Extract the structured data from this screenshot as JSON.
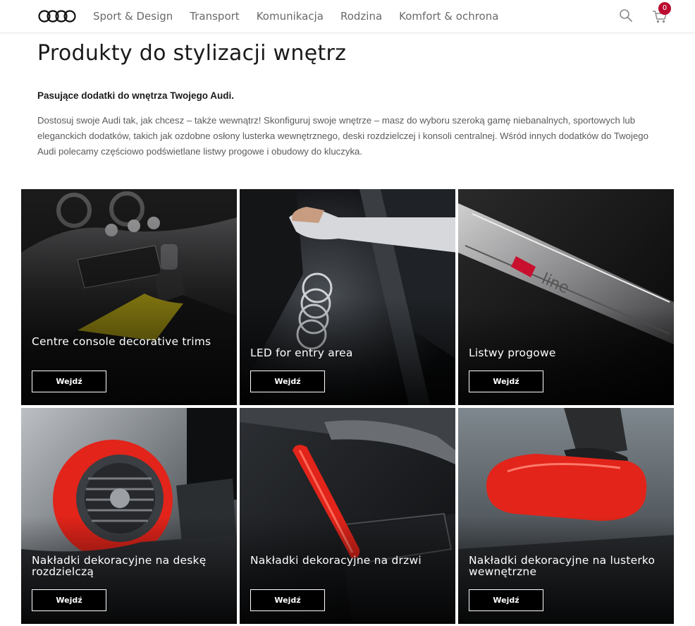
{
  "header": {
    "logo_name": "audi-rings-logo",
    "nav": [
      {
        "label": "Sport & Design"
      },
      {
        "label": "Transport"
      },
      {
        "label": "Komunikacja"
      },
      {
        "label": "Rodzina"
      },
      {
        "label": "Komfort & ochrona"
      }
    ],
    "search_icon": "search-icon",
    "cart_icon": "cart-icon",
    "cart_count": "0"
  },
  "page": {
    "title": "Produkty do stylizacji wnętrz",
    "lead": "Pasujące dodatki do wnętrza Twojego Audi.",
    "description": "Dostosuj swoje Audi tak, jak chcesz – także wewnątrz! Skonfiguruj swoje wnętrze – masz do wyboru szeroką gamę niebanalnych, sportowych lub eleganckich dodatków, takich jak ozdobne osłony lusterka wewnętrznego, deski rozdzielczej i konsoli centralnej. Wśród innych dodatków do Twojego Audi polecamy częściowo podświetlane listwy progowe i obudowy do kluczyka."
  },
  "tiles": [
    {
      "title": "Centre console decorative trims",
      "button": "Wejdź"
    },
    {
      "title": "LED for entry area",
      "button": "Wejdź"
    },
    {
      "title": "Listwy progowe",
      "button": "Wejdź",
      "badge_text": "line"
    },
    {
      "title": "Nakładki dekoracyjne na deskę rozdzielczą",
      "button": "Wejdź"
    },
    {
      "title": "Nakładki dekoracyjne na drzwi",
      "button": "Wejdź"
    },
    {
      "title": "Nakładki dekoracyjne na lusterko wewnętrzne",
      "button": "Wejdź"
    }
  ],
  "colors": {
    "brand_red": "#bb0a30",
    "trim_yellow": "#d8c51a",
    "trim_red": "#e2241a",
    "nav_text": "#6a6a6a"
  }
}
